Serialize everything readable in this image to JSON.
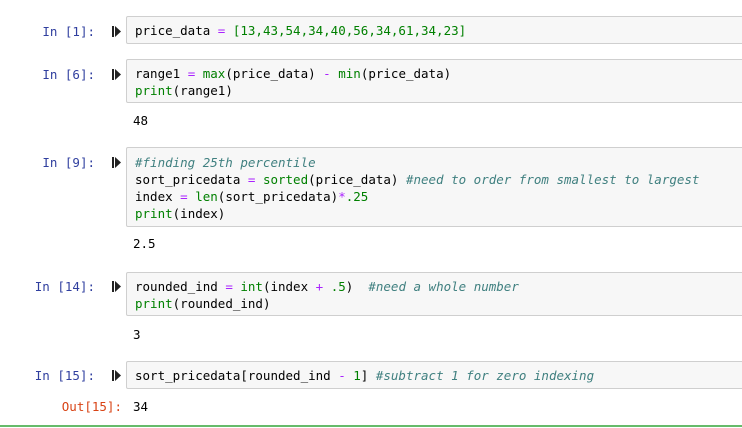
{
  "cells": [
    {
      "prompt": "In [1]:",
      "lines": [
        [
          {
            "t": "price_data "
          },
          {
            "t": "=",
            "c": "op"
          },
          {
            "t": " [13,43,54,34,40,56,34,61,34,23]",
            "c": "num"
          }
        ]
      ],
      "output": ""
    },
    {
      "prompt": "In [6]:",
      "lines": [
        [
          {
            "t": "range1 "
          },
          {
            "t": "=",
            "c": "op"
          },
          {
            "t": " "
          },
          {
            "t": "max",
            "c": "kw"
          },
          {
            "t": "(price_data) "
          },
          {
            "t": "-",
            "c": "op"
          },
          {
            "t": " "
          },
          {
            "t": "min",
            "c": "kw"
          },
          {
            "t": "(price_data)"
          }
        ],
        [
          {
            "t": "print",
            "c": "kw"
          },
          {
            "t": "(range1)"
          }
        ]
      ],
      "output": "48"
    },
    {
      "prompt": "In [9]:",
      "lines": [
        [
          {
            "t": "#finding 25th percentile",
            "c": "cm"
          }
        ],
        [
          {
            "t": "sort_pricedata "
          },
          {
            "t": "=",
            "c": "op"
          },
          {
            "t": " "
          },
          {
            "t": "sorted",
            "c": "kw"
          },
          {
            "t": "(price_data) "
          },
          {
            "t": "#need to order from smallest to largest",
            "c": "cm"
          }
        ],
        [
          {
            "t": "index "
          },
          {
            "t": "=",
            "c": "op"
          },
          {
            "t": " "
          },
          {
            "t": "len",
            "c": "kw"
          },
          {
            "t": "(sort_pricedata)"
          },
          {
            "t": "*",
            "c": "op"
          },
          {
            "t": ".25",
            "c": "num"
          }
        ],
        [
          {
            "t": "print",
            "c": "kw"
          },
          {
            "t": "(index)"
          }
        ]
      ],
      "output": "2.5"
    },
    {
      "prompt": "In [14]:",
      "lines": [
        [
          {
            "t": "rounded_ind "
          },
          {
            "t": "=",
            "c": "op"
          },
          {
            "t": " "
          },
          {
            "t": "int",
            "c": "kw"
          },
          {
            "t": "(index "
          },
          {
            "t": "+",
            "c": "op"
          },
          {
            "t": " "
          },
          {
            "t": ".5",
            "c": "num"
          },
          {
            "t": ")  "
          },
          {
            "t": "#need a whole number",
            "c": "cm"
          }
        ],
        [
          {
            "t": "print",
            "c": "kw"
          },
          {
            "t": "(rounded_ind)"
          }
        ]
      ],
      "output": "3"
    },
    {
      "prompt": "In [15]:",
      "lines": [
        [
          {
            "t": "sort_pricedata[rounded_ind "
          },
          {
            "t": "-",
            "c": "op"
          },
          {
            "t": " "
          },
          {
            "t": "1",
            "c": "num"
          },
          {
            "t": "] "
          },
          {
            "t": "#subtract 1 for zero indexing",
            "c": "cm"
          }
        ]
      ],
      "out_prompt": "Out[15]:",
      "output": "34"
    }
  ],
  "icons": {
    "run": "run-cell-icon"
  },
  "colors": {
    "in_prompt": "#303f9f",
    "out_prompt": "#d84315",
    "builtin": "#008000",
    "operator": "#aa22ff",
    "comment": "#408080"
  }
}
